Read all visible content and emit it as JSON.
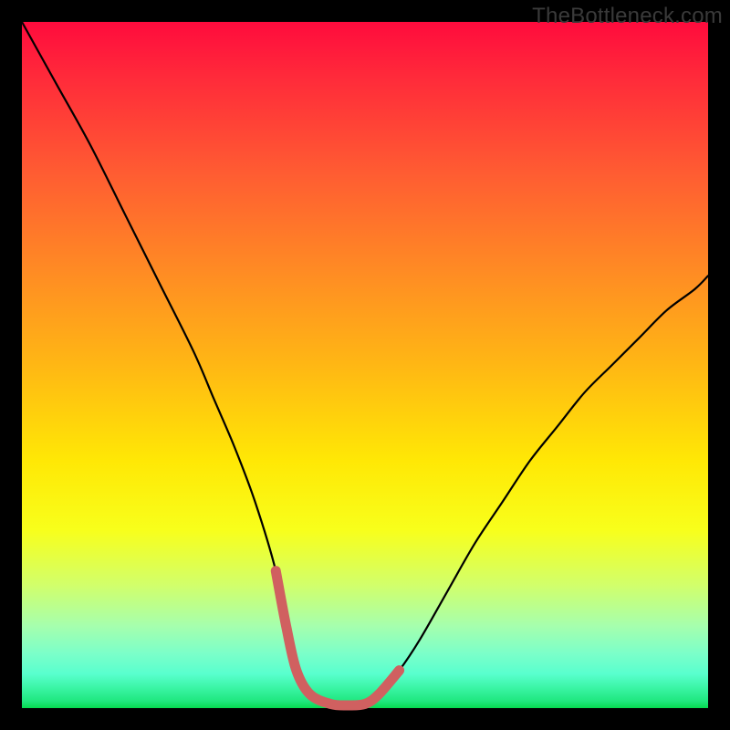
{
  "attribution": "TheBottleneck.com",
  "chart_data": {
    "type": "line",
    "title": "",
    "xlabel": "",
    "ylabel": "",
    "xlim": [
      0,
      100
    ],
    "ylim": [
      0,
      100
    ],
    "grid": false,
    "legend": false,
    "series": [
      {
        "name": "black-curve",
        "color": "#000000",
        "x": [
          0,
          5,
          10,
          15,
          20,
          25,
          28,
          31,
          34,
          37,
          38.5,
          40,
          42,
          45,
          47.5,
          50,
          52,
          55,
          58,
          62,
          66,
          70,
          74,
          78,
          82,
          86,
          90,
          94,
          98,
          100
        ],
        "values": [
          100,
          91,
          82,
          72,
          62,
          52,
          45,
          38,
          30,
          20,
          12,
          5.5,
          2.0,
          0.6,
          0.4,
          0.6,
          2.0,
          5.5,
          10,
          17,
          24,
          30,
          36,
          41,
          46,
          50,
          54,
          58,
          61,
          63
        ]
      },
      {
        "name": "highlight-segment",
        "color": "#d06060",
        "x": [
          37,
          38.5,
          40,
          42,
          45,
          47.5,
          50,
          52,
          55
        ],
        "values": [
          20,
          12,
          5.5,
          2.0,
          0.6,
          0.4,
          0.6,
          2.0,
          5.5
        ]
      }
    ],
    "annotations": []
  }
}
